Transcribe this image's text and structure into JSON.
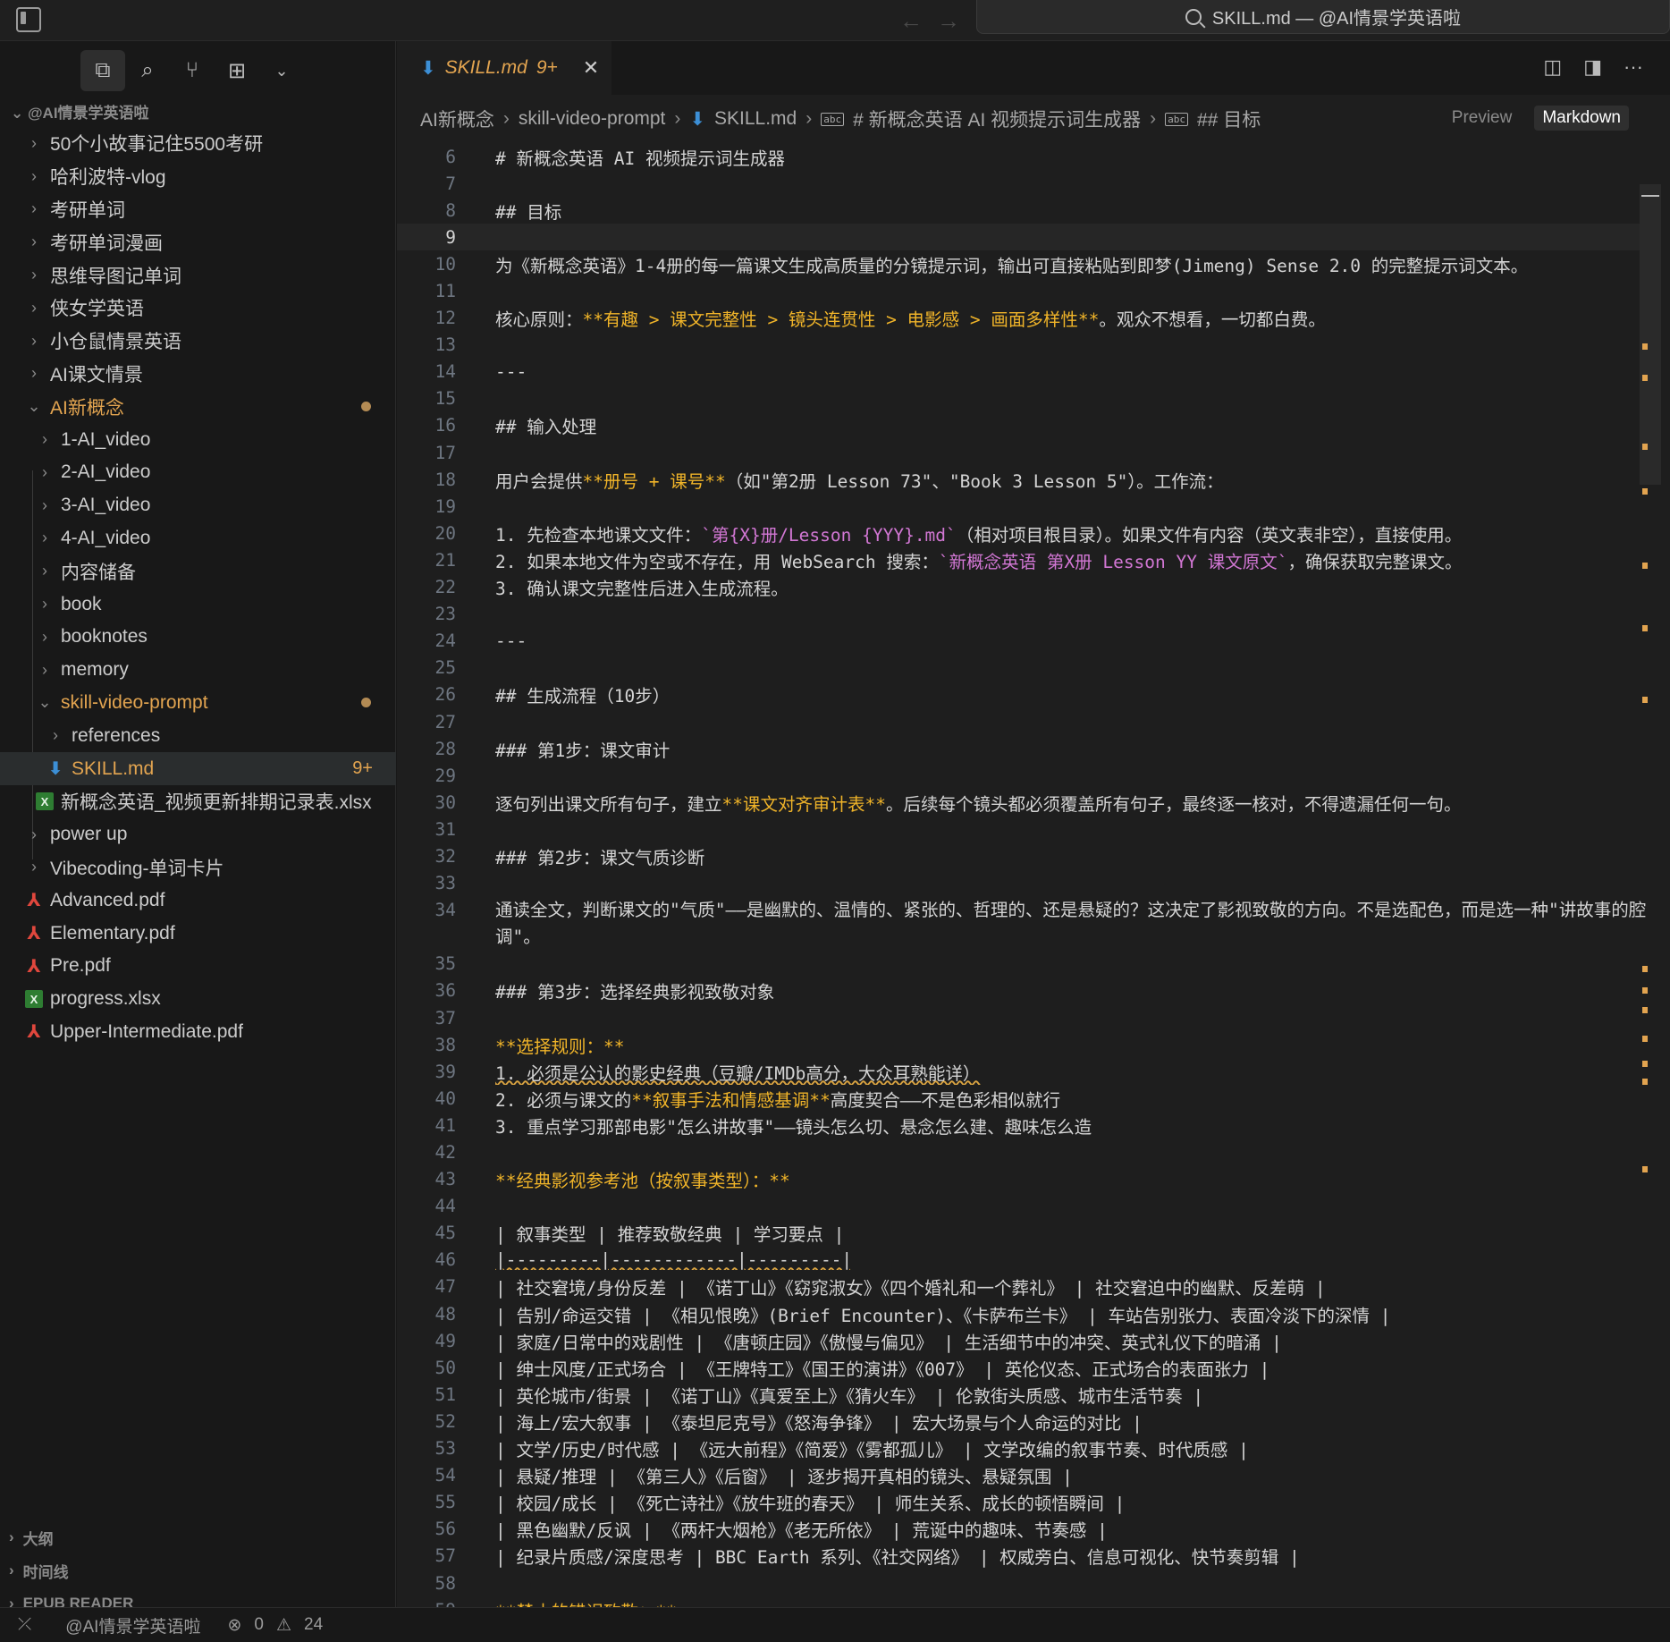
{
  "titlebar": {
    "search_title": "SKILL.md — @AI情景学英语啦"
  },
  "sidebar": {
    "workspace": "@AI情景学英语啦",
    "items": [
      {
        "label": "50个小故事记住5500考研",
        "indent": 0,
        "chev": "›"
      },
      {
        "label": "哈利波特-vlog",
        "indent": 0,
        "chev": "›"
      },
      {
        "label": "考研单词",
        "indent": 0,
        "chev": "›"
      },
      {
        "label": "考研单词漫画",
        "indent": 0,
        "chev": "›"
      },
      {
        "label": "思维导图记单词",
        "indent": 0,
        "chev": "›"
      },
      {
        "label": "侠女学英语",
        "indent": 0,
        "chev": "›"
      },
      {
        "label": "小仓鼠情景英语",
        "indent": 0,
        "chev": "›"
      },
      {
        "label": "AI课文情景",
        "indent": 0,
        "chev": "›"
      },
      {
        "label": "AI新概念",
        "indent": 0,
        "chev": "⌄",
        "mod": true,
        "dot": true
      },
      {
        "label": "1-AI_video",
        "indent": 1,
        "chev": "›"
      },
      {
        "label": "2-AI_video",
        "indent": 1,
        "chev": "›"
      },
      {
        "label": "3-AI_video",
        "indent": 1,
        "chev": "›"
      },
      {
        "label": "4-AI_video",
        "indent": 1,
        "chev": "›"
      },
      {
        "label": "内容储备",
        "indent": 1,
        "chev": "›"
      },
      {
        "label": "book",
        "indent": 1,
        "chev": "›"
      },
      {
        "label": "booknotes",
        "indent": 1,
        "chev": "›"
      },
      {
        "label": "memory",
        "indent": 1,
        "chev": "›"
      },
      {
        "label": "skill-video-prompt",
        "indent": 1,
        "chev": "⌄",
        "mod": true,
        "dot": true
      },
      {
        "label": "references",
        "indent": 2,
        "chev": "›"
      },
      {
        "label": "SKILL.md",
        "indent": 2,
        "icon": "md",
        "mod": true,
        "sel": true,
        "badge": "9+"
      },
      {
        "label": "新概念英语_视频更新排期记录表.xlsx",
        "indent": 1,
        "icon": "xls"
      },
      {
        "label": "power up",
        "indent": 0,
        "chev": "›"
      },
      {
        "label": "Vibecoding-单词卡片",
        "indent": 0,
        "chev": "›"
      },
      {
        "label": "Advanced.pdf",
        "indent": 0,
        "icon": "pdf"
      },
      {
        "label": "Elementary.pdf",
        "indent": 0,
        "icon": "pdf"
      },
      {
        "label": "Pre.pdf",
        "indent": 0,
        "icon": "pdf"
      },
      {
        "label": "progress.xlsx",
        "indent": 0,
        "icon": "xls"
      },
      {
        "label": "Upper-Intermediate.pdf",
        "indent": 0,
        "icon": "pdf"
      }
    ],
    "bottom": [
      "大纲",
      "时间线",
      "EPUB READER"
    ]
  },
  "tab": {
    "label": "SKILL.md",
    "badge": "9+"
  },
  "breadcrumb": [
    "AI新概念",
    "skill-video-prompt",
    "SKILL.md",
    "# 新概念英语 AI 视频提示词生成器",
    "## 目标"
  ],
  "mode": {
    "preview": "Preview",
    "markdown": "Markdown"
  },
  "lines": [
    {
      "n": "6",
      "t": "# 新概念英语 AI 视频提示词生成器"
    },
    {
      "n": "7",
      "t": ""
    },
    {
      "n": "8",
      "t": "## 目标"
    },
    {
      "n": "9",
      "t": "",
      "cur": true
    },
    {
      "n": "10",
      "t": "为《新概念英语》1-4册的每一篇课文生成高质量的分镜提示词，输出可直接粘贴到即梦(Jimeng) Sense 2.0 的完整提示词文本。"
    },
    {
      "n": "11",
      "t": ""
    },
    {
      "n": "12",
      "p": [
        {
          "t": "核心原则："
        },
        {
          "t": "**有趣 > 课文完整性 > 镜头连贯性 > 电影感 > 画面多样性**",
          "c": "hl"
        },
        {
          "t": "。观众不想看，一切都白费。"
        }
      ]
    },
    {
      "n": "13",
      "t": ""
    },
    {
      "n": "14",
      "t": "---"
    },
    {
      "n": "15",
      "t": ""
    },
    {
      "n": "16",
      "t": "## 输入处理"
    },
    {
      "n": "17",
      "t": ""
    },
    {
      "n": "18",
      "p": [
        {
          "t": "用户会提供"
        },
        {
          "t": "**册号 + 课号**",
          "c": "hl"
        },
        {
          "t": "（如\"第2册 Lesson 73\"、\"Book 3 Lesson 5\"）。工作流："
        }
      ]
    },
    {
      "n": "19",
      "t": ""
    },
    {
      "n": "20",
      "p": [
        {
          "t": "1. 先检查本地课文文件："
        },
        {
          "t": "`第{X}册/Lesson {YYY}.md`",
          "c": "pk"
        },
        {
          "t": "（相对项目根目录）。如果文件有内容（英文表非空），直接使用。"
        }
      ]
    },
    {
      "n": "21",
      "p": [
        {
          "t": "2. 如果本地文件为空或不存在，用 WebSearch 搜索："
        },
        {
          "t": "`新概念英语 第X册 Lesson YY 课文原文`",
          "c": "pk"
        },
        {
          "t": "，确保获取完整课文。"
        }
      ]
    },
    {
      "n": "22",
      "t": "3. 确认课文完整性后进入生成流程。"
    },
    {
      "n": "23",
      "t": ""
    },
    {
      "n": "24",
      "t": "---"
    },
    {
      "n": "25",
      "t": ""
    },
    {
      "n": "26",
      "t": "## 生成流程（10步）"
    },
    {
      "n": "27",
      "t": ""
    },
    {
      "n": "28",
      "t": "### 第1步：课文审计"
    },
    {
      "n": "29",
      "t": ""
    },
    {
      "n": "30",
      "p": [
        {
          "t": "逐句列出课文所有句子，建立"
        },
        {
          "t": "**课文对齐审计表**",
          "c": "hl"
        },
        {
          "t": "。后续每个镜头都必须覆盖所有句子，最终逐一核对，不得遗漏任何一句。"
        }
      ]
    },
    {
      "n": "31",
      "t": ""
    },
    {
      "n": "32",
      "t": "### 第2步：课文气质诊断"
    },
    {
      "n": "33",
      "t": ""
    },
    {
      "n": "34",
      "t": "通读全文，判断课文的\"气质\"——是幽默的、温情的、紧张的、哲理的、还是悬疑的？这决定了影视致敬的方向。不是选配色，而是选一种\"讲故事的腔调\"。",
      "tall": true
    },
    {
      "n": "35",
      "t": ""
    },
    {
      "n": "36",
      "t": "### 第3步：选择经典影视致敬对象"
    },
    {
      "n": "37",
      "t": ""
    },
    {
      "n": "38",
      "p": [
        {
          "t": "**选择规则：**",
          "c": "hl"
        }
      ]
    },
    {
      "n": "39",
      "p": [
        {
          "t": "1. 必须是公认的影史经典（豆瓣/IMDb高分，大众耳熟能详）",
          "c": "wv"
        }
      ]
    },
    {
      "n": "40",
      "p": [
        {
          "t": "2. 必须与课文的"
        },
        {
          "t": "**叙事手法和情感基调**",
          "c": "hl"
        },
        {
          "t": "高度契合——不是色彩相似就行"
        }
      ]
    },
    {
      "n": "41",
      "t": "3. 重点学习那部电影\"怎么讲故事\"——镜头怎么切、悬念怎么建、趣味怎么造"
    },
    {
      "n": "42",
      "t": ""
    },
    {
      "n": "43",
      "p": [
        {
          "t": "**经典影视参考池（按叙事类型）：**",
          "c": "hl"
        }
      ]
    },
    {
      "n": "44",
      "t": ""
    },
    {
      "n": "45",
      "t": "| 叙事类型 | 推荐致敬经典 | 学习要点 |"
    },
    {
      "n": "46",
      "p": [
        {
          "t": "|---------|------------|---------|",
          "c": "wv"
        }
      ]
    },
    {
      "n": "47",
      "t": "| 社交窘境/身份反差 | 《诺丁山》《窈窕淑女》《四个婚礼和一个葬礼》 | 社交窘迫中的幽默、反差萌 |"
    },
    {
      "n": "48",
      "t": "| 告别/命运交错 | 《相见恨晚》(Brief Encounter)、《卡萨布兰卡》 | 车站告别张力、表面冷淡下的深情 |"
    },
    {
      "n": "49",
      "t": "| 家庭/日常中的戏剧性 | 《唐顿庄园》《傲慢与偏见》 | 生活细节中的冲突、英式礼仪下的暗涌 |"
    },
    {
      "n": "50",
      "t": "| 绅士风度/正式场合 | 《王牌特工》《国王的演讲》《007》 | 英伦仪态、正式场合的表面张力 |"
    },
    {
      "n": "51",
      "t": "| 英伦城市/街景 | 《诺丁山》《真爱至上》《猜火车》 | 伦敦街头质感、城市生活节奏 |"
    },
    {
      "n": "52",
      "t": "| 海上/宏大叙事 | 《泰坦尼克号》《怒海争锋》 | 宏大场景与个人命运的对比 |"
    },
    {
      "n": "53",
      "t": "| 文学/历史/时代感 | 《远大前程》《简爱》《雾都孤儿》 | 文学改编的叙事节奏、时代质感 |"
    },
    {
      "n": "54",
      "t": "| 悬疑/推理 | 《第三人》《后窗》 | 逐步揭开真相的镜头、悬疑氛围 |"
    },
    {
      "n": "55",
      "t": "| 校园/成长 | 《死亡诗社》《放牛班的春天》 | 师生关系、成长的顿悟瞬间 |"
    },
    {
      "n": "56",
      "t": "| 黑色幽默/反讽 | 《两杆大烟枪》《老无所依》 | 荒诞中的趣味、节奏感 |"
    },
    {
      "n": "57",
      "t": "| 纪录片质感/深度思考 | BBC Earth 系列、《社交网络》 | 权威旁白、信息可视化、快节奏剪辑 |"
    },
    {
      "n": "58",
      "t": ""
    },
    {
      "n": "59",
      "p": [
        {
          "t": "**禁止的错误致敬：**",
          "c": "hl"
        }
      ]
    }
  ],
  "status": {
    "workspace": "@AI情景学英语啦",
    "errors": "0",
    "warnings": "24"
  },
  "colors": {
    "accent": "#e2a450",
    "code_highlight": "#f0b429",
    "code_string": "#d277d4"
  }
}
